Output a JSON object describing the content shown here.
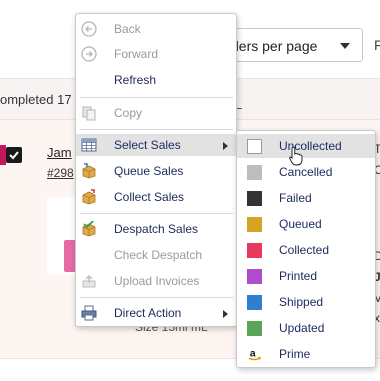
{
  "toolbar": {
    "orders_per_page_label": "ders per page",
    "right_fragment": "F"
  },
  "summary": {
    "completed_text": "ompleted 17"
  },
  "order_row": {
    "customer_name": "Jam",
    "order_number": "#298",
    "size_text": "Size  15ml mL",
    "right_fragments": [
      "T",
      "C",
      "D",
      "J",
      "V",
      "x"
    ]
  },
  "context_menu": {
    "items": [
      {
        "label": "Back",
        "icon": "back-circle-icon",
        "enabled": false
      },
      {
        "label": "Forward",
        "icon": "forward-circle-icon",
        "enabled": false
      },
      {
        "label": "Refresh",
        "icon": "",
        "enabled": true
      },
      {
        "label": "Copy",
        "icon": "copy-icon",
        "enabled": false
      },
      {
        "label": "Select Sales",
        "icon": "table-select-icon",
        "enabled": true,
        "submenu": true,
        "highlighted": true
      },
      {
        "label": "Queue Sales",
        "icon": "box-queue-icon",
        "enabled": true
      },
      {
        "label": "Collect Sales",
        "icon": "box-collect-icon",
        "enabled": true
      },
      {
        "label": "Despatch Sales",
        "icon": "box-despatch-icon",
        "enabled": true
      },
      {
        "label": "Check Despatch",
        "icon": "",
        "enabled": false
      },
      {
        "label": "Upload Invoices",
        "icon": "upload-icon",
        "enabled": false
      },
      {
        "label": "Direct Action",
        "icon": "printer-icon",
        "enabled": true,
        "submenu": true
      }
    ]
  },
  "select_sales_submenu": {
    "items": [
      {
        "label": "Uncollected",
        "color": "#ffffff",
        "highlighted": true
      },
      {
        "label": "Cancelled",
        "color": "#bdbdbd"
      },
      {
        "label": "Failed",
        "color": "#333333"
      },
      {
        "label": "Queued",
        "color": "#d6a424"
      },
      {
        "label": "Collected",
        "color": "#e8385e"
      },
      {
        "label": "Printed",
        "color": "#b04ccc"
      },
      {
        "label": "Shipped",
        "color": "#2f7fd0"
      },
      {
        "label": "Updated",
        "color": "#5aa55a"
      },
      {
        "label": "Prime",
        "color": "",
        "icon": "amazon-icon"
      }
    ]
  },
  "colors": {
    "menu_text": "#1d2a5c",
    "disabled_text": "#9a9a9a",
    "highlight_bg": "#e2e2e2",
    "row_bg": "#fdf5f2"
  }
}
